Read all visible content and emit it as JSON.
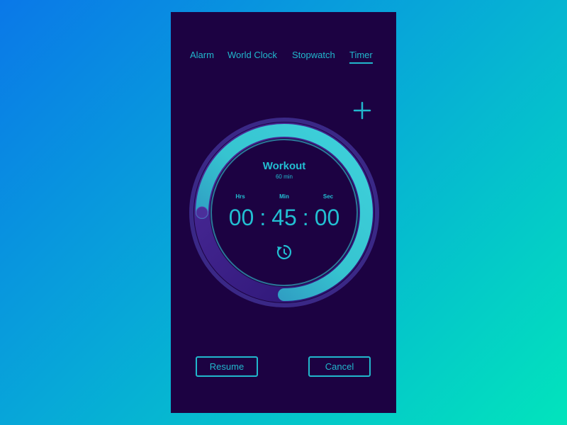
{
  "tabs": [
    {
      "label": "Alarm",
      "active": false
    },
    {
      "label": "World Clock",
      "active": false
    },
    {
      "label": "Stopwatch",
      "active": false
    },
    {
      "label": "Timer",
      "active": true
    }
  ],
  "add_icon": "plus-icon",
  "timer": {
    "name": "Workout",
    "duration_label": "60 min",
    "units": {
      "hours": "Hrs",
      "minutes": "Min",
      "seconds": "Sec"
    },
    "hours": "00",
    "minutes": "45",
    "seconds": "00",
    "separator": ":",
    "remaining_fraction": 0.75,
    "reset_icon": "reset-icon"
  },
  "actions": {
    "resume_label": "Resume",
    "cancel_label": "Cancel"
  },
  "colors": {
    "background": "#1c0242",
    "accent": "#21b8cd",
    "ring_track": "#3a2080",
    "ring_progress": "#34cbd6"
  }
}
